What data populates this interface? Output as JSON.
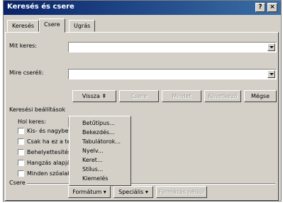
{
  "window": {
    "title": "Keresés és csere",
    "help_glyph": "?",
    "close_glyph": "×"
  },
  "tabs": [
    {
      "label": "Keresés"
    },
    {
      "label": "Csere"
    },
    {
      "label": "Ugrás"
    }
  ],
  "active_tab": "Csere",
  "find": {
    "label": "Mit keres:",
    "value": ""
  },
  "replace": {
    "label": "Mire cseréli:",
    "value": ""
  },
  "buttons": {
    "less": "Vissza",
    "less_glyph": "⇞",
    "replace": "Csere",
    "replace_all": "Mindet",
    "find_next": "Következő",
    "cancel": "Mégse",
    "format": "Formátum",
    "special": "Speciális",
    "no_formatting": "Formázás nélkül",
    "dropdown_glyph": "▾"
  },
  "search_options": {
    "heading": "Keresési beállítások",
    "search_label": "Hol keres:",
    "checkboxes": [
      "Kis- és nagybetű",
      "Csak ha ez a telj",
      "Behelyettesítése",
      "Hangzás alapján",
      "Minden szóalak"
    ]
  },
  "replace_section_label": "Csere",
  "format_menu": {
    "items": [
      "Betűtípus...",
      "Bekezdés...",
      "Tabulátorok...",
      "Nyelv...",
      "Keret...",
      "Stílus...",
      "Kiemelés"
    ]
  },
  "colors": {
    "titlebar": "#0a246a",
    "face": "#d4d0c8"
  }
}
